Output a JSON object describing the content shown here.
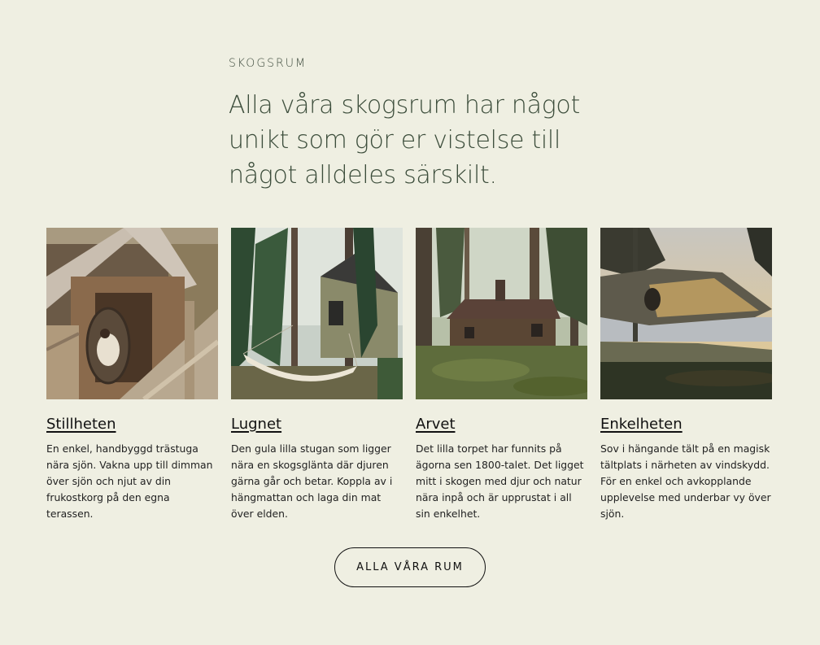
{
  "section": {
    "eyebrow": "SKOGSRUM",
    "headline": "Alla våra skogsrum har något unikt som gör er vistelse till något alldeles särskilt."
  },
  "cards": [
    {
      "title": "Stillheten",
      "description": "En enkel, handbyggd trästuga nära sjön. Vakna upp till dimman över sjön och njut av din frukostkorg på den egna terassen.",
      "image": "cabin-porch-hanging-chair-photo"
    },
    {
      "title": "Lugnet",
      "description": "Den gula lilla stugan som ligger nära en skogsglänta där djuren gärna går och betar. Koppla av i hängmattan och laga din mat över elden.",
      "image": "yellow-cabin-hammock-forest-photo"
    },
    {
      "title": "Arvet",
      "description": "Det lilla torpet har funnits på ägorna sen 1800-talet. Det ligget mitt i skogen med djur och natur nära inpå och är upprustat i all sin enkelhet.",
      "image": "old-log-cabin-forest-photo"
    },
    {
      "title": "Enkelheten",
      "description": "Sov i hängande tält på en magisk tältplats i närheten av vindskydd. För en enkel och avkopplande upplevelse med underbar vy över sjön.",
      "image": "tree-tent-sunset-lake-photo"
    }
  ],
  "cta": {
    "label": "ALLA VÅRA RUM"
  },
  "colors": {
    "background": "#efefe2",
    "heading": "#3c4d3b",
    "text": "#1e1e1e"
  }
}
